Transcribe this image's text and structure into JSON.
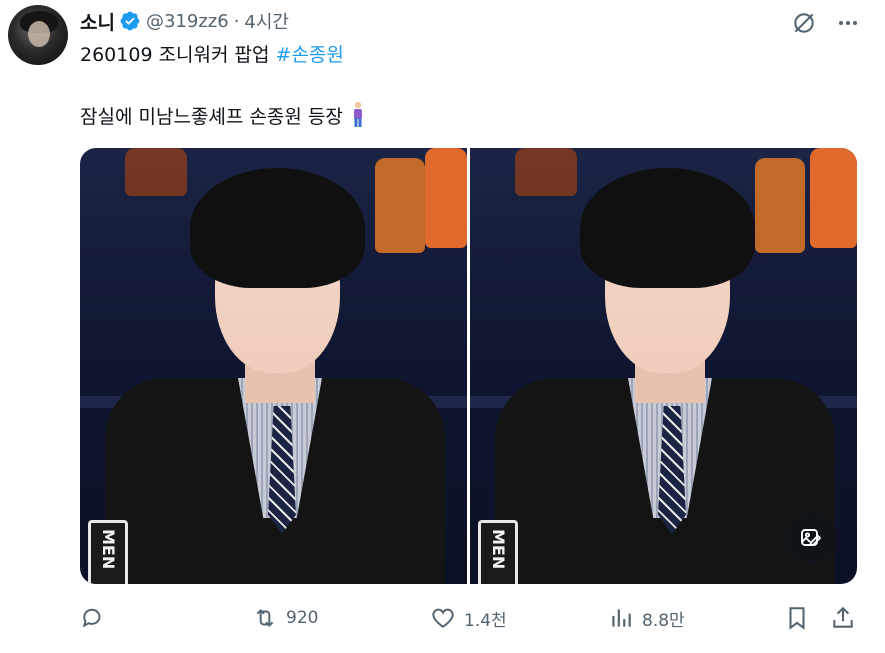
{
  "tweet": {
    "display_name": "소니",
    "handle": "@319zz6",
    "separator": "·",
    "time": "4시간",
    "line1_text": "260109 조니워커 팝업 ",
    "hashtag": "#손종원",
    "line2_text": "잠실에 미남느좋셰프 손종원 등장",
    "emoji": "person-standing-emoji"
  },
  "media": {
    "photo_count": 2,
    "badge_text": "MEN"
  },
  "actions": {
    "reply_count": "",
    "retweet_count": "920",
    "like_count": "1.4천",
    "view_count": "8.8만"
  },
  "colors": {
    "accent": "#1d9bf0",
    "text": "#0f1419",
    "muted": "#536471"
  },
  "icons": [
    "verified-icon",
    "grok-icon",
    "more-icon",
    "edit-image-icon",
    "reply-icon",
    "retweet-icon",
    "like-icon",
    "views-icon",
    "bookmark-icon",
    "share-icon"
  ]
}
